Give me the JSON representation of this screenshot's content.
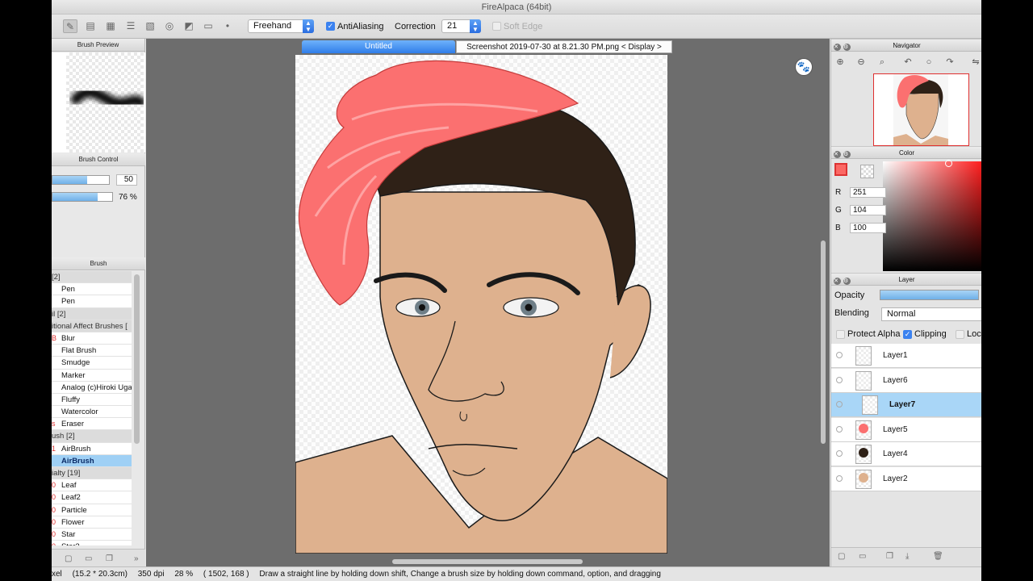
{
  "window": {
    "title": "FireAlpaca (64bit)"
  },
  "toolbar": {
    "stroke_mode": "Freehand",
    "antialiasing_label": "AntiAliasing",
    "antialiasing_checked": true,
    "correction_label": "Correction",
    "correction_value": "21",
    "soft_edge_label": "Soft Edge",
    "soft_edge_checked": false
  },
  "brush_preview": {
    "title": "Brush Preview"
  },
  "brush_control": {
    "title": "Brush Control",
    "size_value": "50",
    "size_fraction": 0.62,
    "opacity_value": "76 %",
    "opacity_fraction": 0.76
  },
  "brush": {
    "title": "Brush",
    "items": [
      {
        "label": "[2]",
        "type": "group"
      },
      {
        "label": "Pen",
        "type": "item"
      },
      {
        "label": "Pen",
        "type": "item"
      },
      {
        "label": "il [2]",
        "type": "group"
      },
      {
        "label": "itional Affect Brushes [",
        "type": "group"
      },
      {
        "label": "Blur",
        "type": "item",
        "mark": "B"
      },
      {
        "label": "Flat Brush",
        "type": "item"
      },
      {
        "label": "Smudge",
        "type": "item"
      },
      {
        "label": "Marker",
        "type": "item"
      },
      {
        "label": "Analog (c)Hiroki Uga",
        "type": "item"
      },
      {
        "label": "Fluffy",
        "type": "item"
      },
      {
        "label": "Watercolor",
        "type": "item"
      },
      {
        "label": "Eraser",
        "type": "item",
        "mark": "s"
      },
      {
        "label": "ush [2]",
        "type": "group"
      },
      {
        "label": "AirBrush",
        "type": "item",
        "mark": "1"
      },
      {
        "label": "AirBrush",
        "type": "item",
        "selected": true
      },
      {
        "label": "ialty [19]",
        "type": "group"
      },
      {
        "label": "Leaf",
        "type": "item",
        "mark": "0"
      },
      {
        "label": "Leaf2",
        "type": "item",
        "mark": "0"
      },
      {
        "label": "Particle",
        "type": "item",
        "mark": "0"
      },
      {
        "label": "Flower",
        "type": "item",
        "mark": "0"
      },
      {
        "label": "Star",
        "type": "item",
        "mark": "0"
      },
      {
        "label": "Star2",
        "type": "item",
        "mark": "0"
      }
    ]
  },
  "canvas": {
    "tab_active": "Untitled",
    "tab_other": "Screenshot 2019-07-30 at 8.21.30 PM.png < Display >"
  },
  "navigator": {
    "title": "Navigator"
  },
  "color": {
    "title": "Color",
    "r_label": "R",
    "r_value": "251",
    "g_label": "G",
    "g_value": "104",
    "b_label": "B",
    "b_value": "100",
    "current_hex": "#fb6864"
  },
  "layer": {
    "title": "Layer",
    "opacity_label": "Opacity",
    "blending_label": "Blending",
    "blending_value": "Normal",
    "protect_alpha_label": "Protect Alpha",
    "clipping_label": "Clipping",
    "lock_label": "Lock",
    "clipping_checked": true,
    "layers": [
      {
        "name": "Layer1",
        "selected": false
      },
      {
        "name": "Layer6",
        "selected": false
      },
      {
        "name": "Layer7",
        "selected": true
      },
      {
        "name": "Layer5",
        "selected": false
      },
      {
        "name": "Layer4",
        "selected": false
      },
      {
        "name": "Layer2",
        "selected": false
      }
    ]
  },
  "status": {
    "units": "xel",
    "size": "(15.2 * 20.3cm)",
    "dpi": "350 dpi",
    "zoom": "28 %",
    "cursor": "( 1502, 168 )",
    "hint": "Draw a straight line by holding down shift, Change a brush size by holding down command, option, and dragging"
  }
}
